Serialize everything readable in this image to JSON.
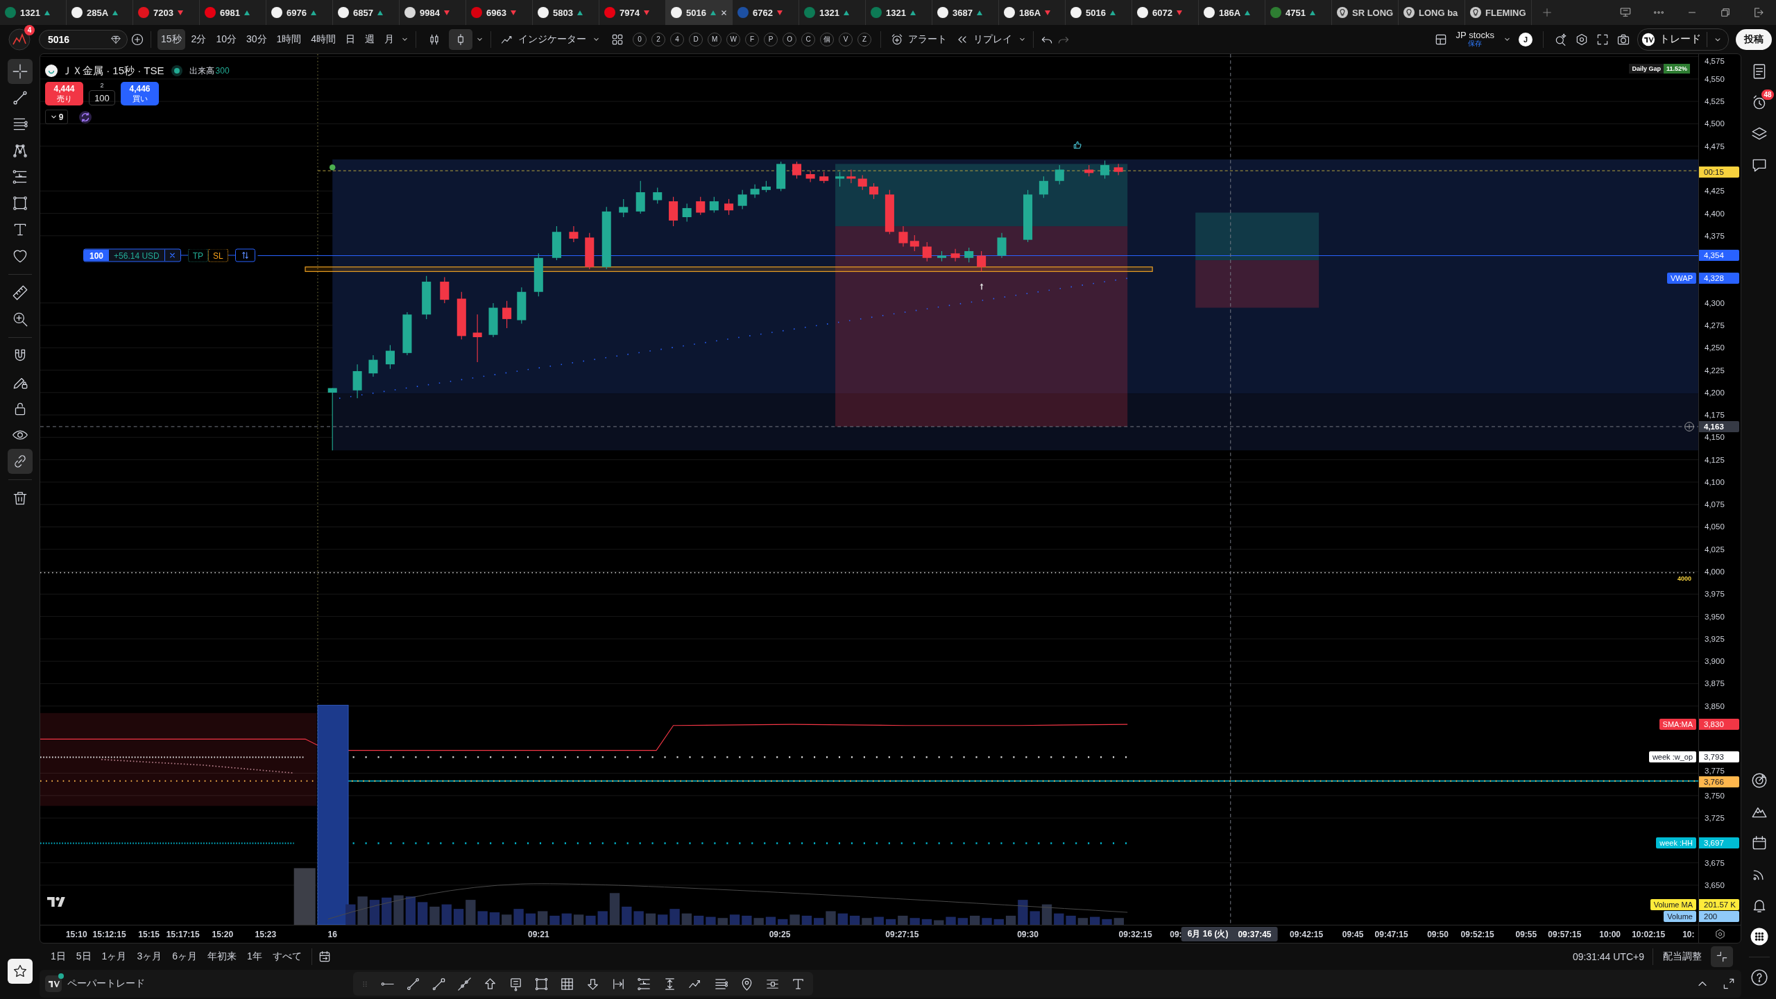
{
  "tabs": [
    {
      "kind": "symbol",
      "label": "1321",
      "rising": true,
      "color": "#0d7a55",
      "selected": false
    },
    {
      "kind": "symbol",
      "label": "285A",
      "rising": true,
      "color": "#f2f2f2",
      "selected": false
    },
    {
      "kind": "symbol",
      "label": "7203",
      "rising": false,
      "color": "#e0141e",
      "selected": false
    },
    {
      "kind": "symbol",
      "label": "6981",
      "rising": true,
      "color": "#e50012",
      "selected": false
    },
    {
      "kind": "symbol",
      "label": "6976",
      "rising": true,
      "color": "#f2f2f2",
      "selected": false
    },
    {
      "kind": "symbol",
      "label": "6857",
      "rising": true,
      "color": "#f2f2f2",
      "selected": false
    },
    {
      "kind": "symbol",
      "label": "9984",
      "rising": false,
      "color": "#d8d8d8",
      "selected": false
    },
    {
      "kind": "symbol",
      "label": "6963",
      "rising": false,
      "color": "#d7000f",
      "selected": false
    },
    {
      "kind": "symbol",
      "label": "5803",
      "rising": true,
      "color": "#f2f2f2",
      "selected": false
    },
    {
      "kind": "symbol",
      "label": "7974",
      "rising": false,
      "color": "#e60012",
      "selected": false
    },
    {
      "kind": "symbol",
      "label": "5016",
      "rising": true,
      "color": "#f2f2f2",
      "selected": true
    },
    {
      "kind": "symbol",
      "label": "6762",
      "rising": false,
      "color": "#1d50a2",
      "selected": false
    },
    {
      "kind": "symbol",
      "label": "1321",
      "rising": true,
      "color": "#0d7a55",
      "selected": false
    },
    {
      "kind": "symbol",
      "label": "1321",
      "rising": true,
      "color": "#0d7a55",
      "selected": false
    },
    {
      "kind": "symbol",
      "label": "3687",
      "rising": true,
      "color": "#f2f2f2",
      "selected": false
    },
    {
      "kind": "symbol",
      "label": "186A",
      "rising": false,
      "color": "#f2f2f2",
      "selected": false
    },
    {
      "kind": "symbol",
      "label": "5016",
      "rising": true,
      "color": "#f2f2f2",
      "selected": false
    },
    {
      "kind": "symbol",
      "label": "6072",
      "rising": false,
      "color": "#f2f2f2",
      "selected": false
    },
    {
      "kind": "symbol",
      "label": "186A",
      "rising": true,
      "color": "#f2f2f2",
      "selected": false
    },
    {
      "kind": "symbol",
      "label": "4751",
      "rising": true,
      "color": "#2e7d32",
      "selected": false
    },
    {
      "kind": "idea",
      "label": "SR LONG",
      "selected": false
    },
    {
      "kind": "idea",
      "label": "LONG ba",
      "selected": false
    },
    {
      "kind": "idea",
      "label": "FLEMING",
      "selected": false
    }
  ],
  "toolbar": {
    "notifications": "4",
    "symbol_search": {
      "value": "5016"
    },
    "intervals": [
      {
        "label": "15秒",
        "selected": true
      },
      {
        "label": "2分",
        "selected": false
      },
      {
        "label": "10分",
        "selected": false
      },
      {
        "label": "30分",
        "selected": false
      },
      {
        "label": "1時間",
        "selected": false
      },
      {
        "label": "4時間",
        "selected": false
      },
      {
        "label": "日",
        "selected": false
      },
      {
        "label": "週",
        "selected": false
      },
      {
        "label": "月",
        "selected": false
      }
    ],
    "chart_types": [
      {
        "kind": "candle-pair",
        "selected": false
      },
      {
        "kind": "candle",
        "selected": true
      }
    ],
    "indicators": "インジケーター",
    "shortcuts": [
      "0",
      "2",
      "4",
      "D",
      "M",
      "W",
      "F",
      "P",
      "O",
      "C",
      "個",
      "V",
      "Z"
    ],
    "alert": "アラート",
    "replay": "リプレイ",
    "layout": {
      "name": "JP stocks",
      "status": "保存"
    },
    "user_initial": "J",
    "trade": "トレード",
    "publish": "投稿"
  },
  "left_toolbar": {
    "groups": [
      [
        {
          "kind": "crosshair",
          "selected": true
        },
        {
          "kind": "trend-line",
          "selected": false
        },
        {
          "kind": "parallel-lines",
          "selected": false
        },
        {
          "kind": "pattern",
          "selected": false
        },
        {
          "kind": "level-lines",
          "selected": false
        },
        {
          "kind": "rectangle",
          "selected": false
        },
        {
          "kind": "text-tool",
          "selected": false
        },
        {
          "kind": "heart",
          "selected": false
        }
      ],
      [
        {
          "kind": "ruler",
          "selected": false
        },
        {
          "kind": "zoom-in",
          "selected": false
        }
      ],
      [
        {
          "kind": "magnet",
          "selected": false
        },
        {
          "kind": "pen-lock",
          "selected": false
        },
        {
          "kind": "lock",
          "selected": false
        },
        {
          "kind": "eye",
          "selected": false
        },
        {
          "kind": "link",
          "selected": true
        }
      ],
      [
        {
          "kind": "trash",
          "selected": false
        }
      ]
    ]
  },
  "chart": {
    "legend": {
      "title": "ＪＸ金属 · 15秒 · TSE",
      "market_open": true,
      "volume_label": "出来高",
      "volume_value": "300"
    },
    "order_panel": {
      "sell": {
        "price": "4,444",
        "label": "売り"
      },
      "spread": "2",
      "quantity": "100",
      "buy": {
        "price": "4,446",
        "label": "買い"
      }
    },
    "indicator_count": "9",
    "daily_gap": {
      "label": "Daily Gap",
      "value": "11.52%"
    },
    "position": {
      "quantity": "100",
      "pnl": "+56.14 USD",
      "take_profit": "TP",
      "stop_loss": "SL"
    },
    "level_note": "4000",
    "price_axis": {
      "ticks": [
        "4,575",
        "4,550",
        "4,525",
        "4,500",
        "4,475",
        "4,425",
        "4,400",
        "4,375",
        "4,300",
        "4,275",
        "4,250",
        "4,225",
        "4,200",
        "4,175",
        "4,150",
        "4,125",
        "4,100",
        "4,075",
        "4,050",
        "4,025",
        "4,000",
        "3,975",
        "3,950",
        "3,925",
        "3,900",
        "3,875",
        "3,850",
        "3,775",
        "3,750",
        "3,725",
        "3,675",
        "3,650"
      ],
      "labels": [
        {
          "kind": "countdown",
          "value": "00:15",
          "color": "#f7d23e"
        },
        {
          "kind": "position",
          "value": "4,354",
          "color": "#2962ff"
        },
        {
          "kind": "indicator",
          "title": "VWAP",
          "value": "4,328",
          "color": "#2962ff"
        },
        {
          "kind": "crosshair",
          "value": "4,163",
          "color": "#363a45"
        },
        {
          "kind": "indicator",
          "title": "SMA:MA",
          "value": "3,830",
          "color": "#f23645"
        },
        {
          "kind": "indicator",
          "title": "week :w_op",
          "value": "3,793",
          "color": "#ffffff"
        },
        {
          "kind": "indicator",
          "value": "3,766",
          "color": "#ffb74d"
        },
        {
          "kind": "indicator",
          "title": "week :HH",
          "value": "3,697",
          "color": "#00bcd4"
        },
        {
          "kind": "indicator",
          "title": "Volume MA",
          "value": "201.57 K",
          "color": "#ffeb3b"
        },
        {
          "kind": "indicator",
          "title": "Volume",
          "value": "200",
          "color": "#90caf9"
        }
      ]
    },
    "time_axis": {
      "ticks": [
        "15:10",
        "15:12:15",
        "15:15",
        "15:17:15",
        "15:20",
        "15:23",
        "16",
        "09:21",
        "09:25",
        "09:27:15",
        "09:30",
        "09:32:15",
        "09:",
        "09:42:15",
        "09:45",
        "09:47:15",
        "09:50",
        "09:52:15",
        "09:55",
        "09:57:15",
        "10:00",
        "10:02:15",
        "10:"
      ],
      "crosshair": {
        "date": "6月 16 (火)",
        "time": "09:37:45"
      }
    }
  },
  "right_sidebar": {
    "top": [
      {
        "kind": "watchlist"
      },
      {
        "kind": "alarm-clock",
        "badge": "48"
      },
      {
        "kind": "layers"
      },
      {
        "kind": "chat"
      }
    ],
    "bottom": [
      {
        "kind": "target"
      },
      {
        "kind": "mountain"
      },
      {
        "kind": "calendar"
      },
      {
        "kind": "broadcast"
      },
      {
        "kind": "bell"
      },
      {
        "kind": "dot-grid"
      },
      {
        "kind": "help"
      }
    ]
  },
  "bottom_bar": {
    "ranges": [
      "1日",
      "5日",
      "1ヶ月",
      "3ヶ月",
      "6ヶ月",
      "年初来",
      "1年",
      "すべて"
    ],
    "clock": "09:31:44 UTC+9",
    "adjustment": "配当調整"
  },
  "bottom_panel": {
    "title": "ペーパートレード",
    "connected": true,
    "tools": [
      {
        "kind": "grip"
      },
      {
        "kind": "horizontal-ray"
      },
      {
        "kind": "trend-line"
      },
      {
        "kind": "ray-box"
      },
      {
        "kind": "extended-line"
      },
      {
        "kind": "arrow-up"
      },
      {
        "kind": "price-note"
      },
      {
        "kind": "rectangle"
      },
      {
        "kind": "table"
      },
      {
        "kind": "arrow-down"
      },
      {
        "kind": "date-range"
      },
      {
        "kind": "level-lines"
      },
      {
        "kind": "price-range"
      },
      {
        "kind": "path"
      },
      {
        "kind": "parallel-lines"
      },
      {
        "kind": "pin"
      },
      {
        "kind": "lines-box"
      },
      {
        "kind": "text-tool"
      }
    ]
  }
}
